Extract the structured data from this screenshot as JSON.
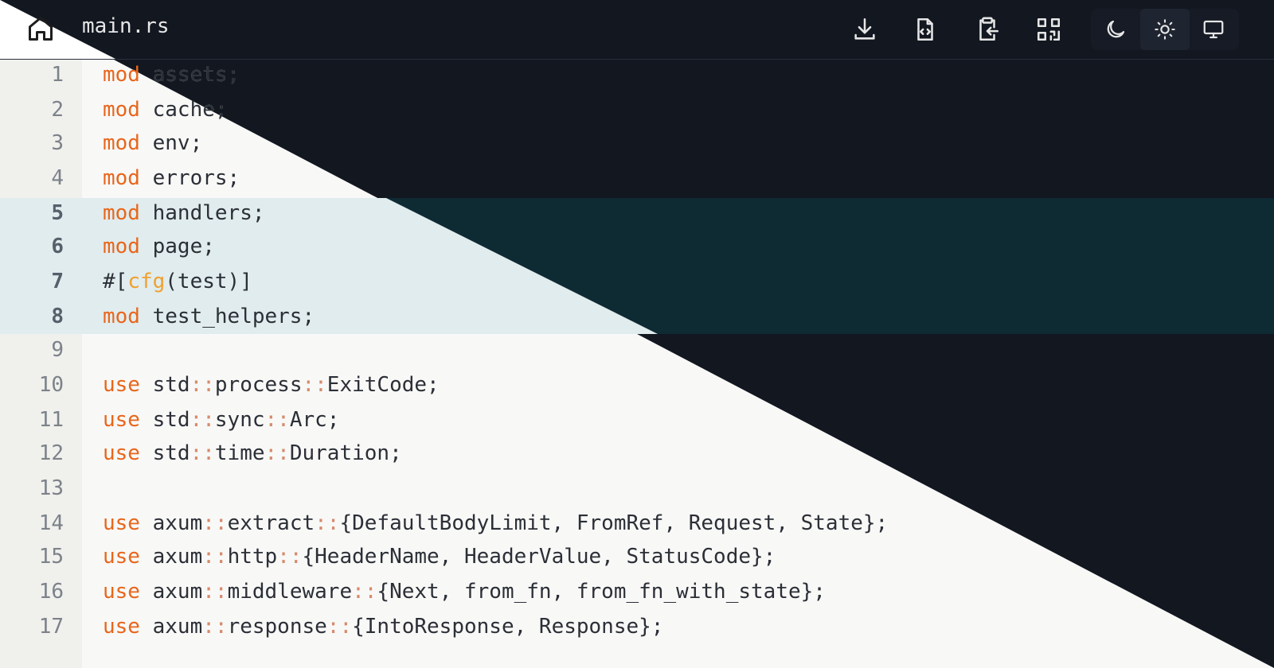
{
  "header": {
    "filename": "main.rs",
    "toolbar": [
      "download-icon",
      "file-code-icon",
      "clipboard-arrow-icon",
      "qr-code-icon"
    ],
    "theme": [
      "moon-icon",
      "sun-icon",
      "monitor-icon"
    ],
    "theme_active": "sun"
  },
  "editor": {
    "highlighted_lines": [
      5,
      6,
      7,
      8
    ],
    "line_numbers": [
      "1",
      "2",
      "3",
      "4",
      "5",
      "6",
      "7",
      "8",
      "9",
      "10",
      "11",
      "12",
      "13",
      "14",
      "15",
      "16",
      "17"
    ],
    "lines": [
      "mod assets;",
      "mod cache;",
      "mod env;",
      "mod errors;",
      "mod handlers;",
      "mod page;",
      "#[cfg(test)]",
      "mod test_helpers;",
      "",
      "use std::process::ExitCode;",
      "use std::sync::Arc;",
      "use std::time::Duration;",
      "",
      "use axum::extract::{DefaultBodyLimit, FromRef, Request, State};",
      "use axum::http::{HeaderName, HeaderValue, StatusCode};",
      "use axum::middleware::{Next, from_fn, from_fn_with_state};",
      "use axum::response::{IntoResponse, Response};"
    ]
  },
  "colors": {
    "keyword": "#e8661b",
    "attribute": "#f0a030",
    "dark_background": "#121720",
    "light_background": "#f8f8f7",
    "highlight_light": "#e0ecee",
    "highlight_dark": "#0e2a33"
  }
}
